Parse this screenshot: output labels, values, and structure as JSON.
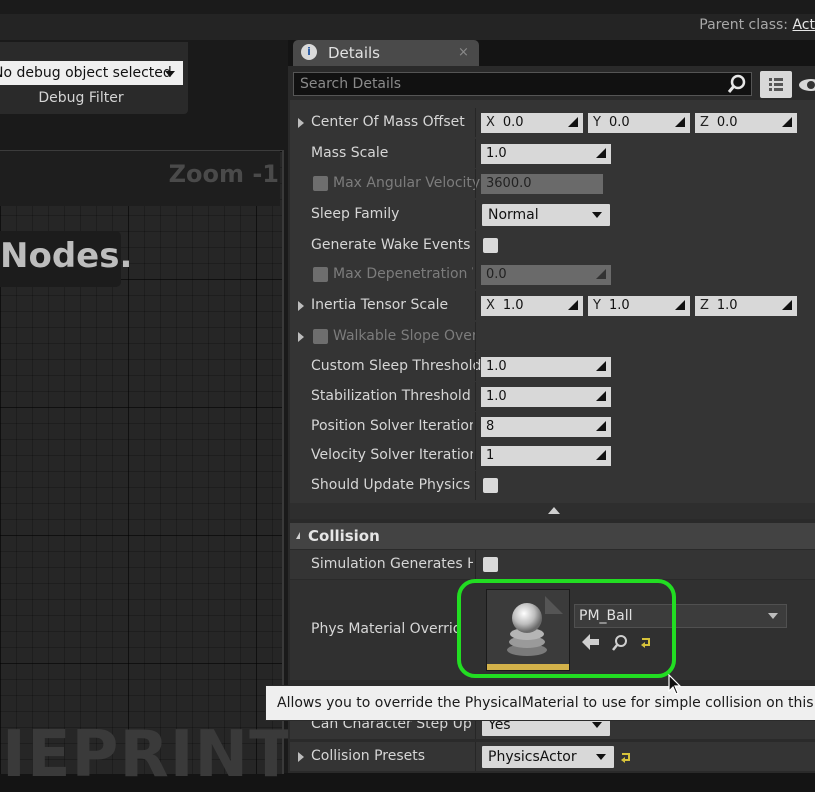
{
  "window": {
    "parent_class_label": "Parent class:",
    "parent_class_value": "Act"
  },
  "debug": {
    "selected_object": "No debug object selected",
    "filter_label": "Debug Filter"
  },
  "graph": {
    "zoom_label": "Zoom -1",
    "nodes_text": "Nodes.",
    "watermark": "IEPRINT"
  },
  "details": {
    "tab_title": "Details",
    "close_glyph": "×",
    "search_placeholder": "Search Details",
    "rows": {
      "center_of_mass": {
        "label": "Center Of Mass Offset",
        "x_label": "X",
        "x": "0.0",
        "y_label": "Y",
        "y": "0.0",
        "z_label": "Z",
        "z": "0.0"
      },
      "mass_scale": {
        "label": "Mass Scale",
        "value": "1.0"
      },
      "max_angular_velocity": {
        "label": "Max Angular Velocity",
        "value": "3600.0"
      },
      "sleep_family": {
        "label": "Sleep Family",
        "value": "Normal"
      },
      "generate_wake_events": {
        "label": "Generate Wake Events"
      },
      "max_depenetration": {
        "label": "Max Depenetration Ve",
        "value": "0.0"
      },
      "inertia_tensor": {
        "label": "Inertia Tensor Scale",
        "x_label": "X",
        "x": "1.0",
        "y_label": "Y",
        "y": "1.0",
        "z_label": "Z",
        "z": "1.0"
      },
      "walkable_slope": {
        "label": "Walkable Slope Overri"
      },
      "custom_sleep": {
        "label": "Custom Sleep Threshold",
        "value": "1.0"
      },
      "stabilization": {
        "label": "Stabilization Threshold M",
        "value": "1.0"
      },
      "position_solver": {
        "label": "Position Solver Iteration",
        "value": "8"
      },
      "velocity_solver": {
        "label": "Velocity Solver Iteration",
        "value": "1"
      },
      "should_update": {
        "label": "Should Update Physics V"
      }
    },
    "collision": {
      "title": "Collision",
      "sim_generates_hit": {
        "label": "Simulation Generates Hit"
      },
      "phys_material": {
        "label": "Phys Material Overrid",
        "value": "PM_Ball"
      },
      "can_character_step": {
        "label": "Can Character Step Up O",
        "value": "Yes"
      },
      "collision_presets": {
        "label": "Collision Presets",
        "value": "PhysicsActor"
      }
    },
    "tooltip": "Allows you to override the PhysicalMaterial to use for simple collision on this body"
  },
  "colors": {
    "highlight": "#22dd22",
    "panel_bg": "#343434"
  },
  "icons": [
    "search-icon",
    "eye-icon",
    "info-icon",
    "view-options-icon",
    "arrow-left-icon",
    "browse-icon",
    "reset-arrow-icon",
    "mouse-cursor-icon"
  ]
}
